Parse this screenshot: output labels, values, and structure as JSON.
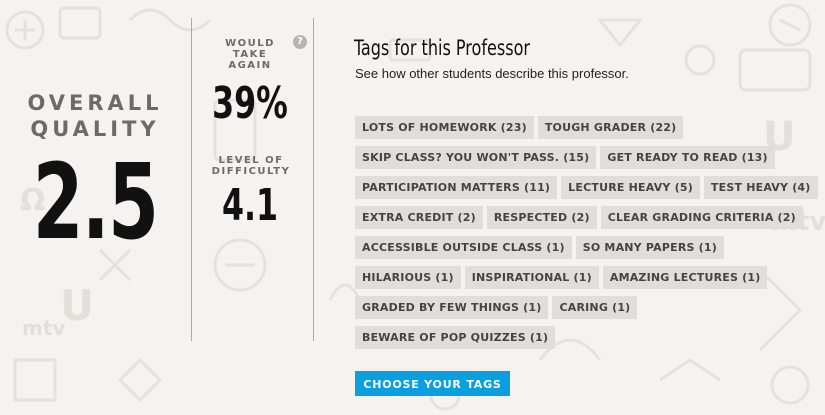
{
  "overall": {
    "label": "OVERALL QUALITY",
    "score": "2.5"
  },
  "would_take_again": {
    "label": "WOULD TAKE AGAIN",
    "value": "39%"
  },
  "difficulty": {
    "label": "LEVEL OF DIFFICULTY",
    "value": "4.1"
  },
  "help_icon": {
    "glyph": "?",
    "icon": "question-icon"
  },
  "tags_section": {
    "title": "Tags for this Professor",
    "subtitle": "See how other students describe this professor.",
    "rows": [
      [
        "LOTS OF HOMEWORK (23)",
        "TOUGH GRADER (22)"
      ],
      [
        "SKIP CLASS? YOU WON'T PASS. (15)",
        "GET READY TO READ (13)"
      ],
      [
        "PARTICIPATION MATTERS (11)",
        "LECTURE HEAVY (5)",
        "TEST HEAVY (4)"
      ],
      [
        "EXTRA CREDIT (2)",
        "RESPECTED (2)",
        "CLEAR GRADING CRITERIA (2)"
      ],
      [
        "ACCESSIBLE OUTSIDE CLASS (1)",
        "SO MANY PAPERS (1)"
      ],
      [
        "HILARIOUS (1)",
        "INSPIRATIONAL (1)",
        "AMAZING LECTURES (1)"
      ],
      [
        "GRADED BY FEW THINGS (1)",
        "CARING (1)"
      ],
      [
        "BEWARE OF POP QUIZZES (1)"
      ]
    ],
    "button_label": "CHOOSE YOUR TAGS"
  },
  "colors": {
    "button": "#0aa0e0",
    "tag_bg": "#dfdedb",
    "background": "#f4f3ef"
  }
}
